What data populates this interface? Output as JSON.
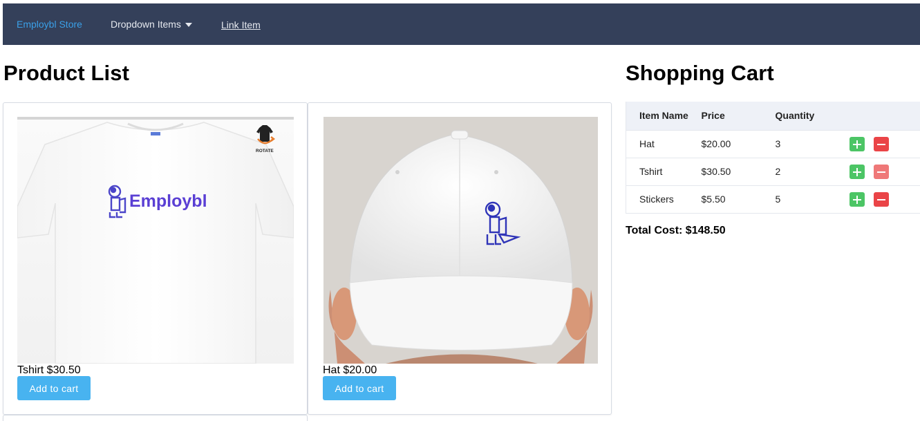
{
  "navbar": {
    "brand": "Employbl Store",
    "dropdown_label": "Dropdown Items",
    "link_label": "Link Item"
  },
  "products": {
    "title": "Product List",
    "items": [
      {
        "name": "Tshirt",
        "price_line": "Tshirt $30.50",
        "button_label": "Add to cart",
        "image_text": "Employbl",
        "rotate_label": "ROTATE"
      },
      {
        "name": "Hat",
        "price_line": "Hat $20.00",
        "button_label": "Add to cart"
      }
    ]
  },
  "cart": {
    "title": "Shopping Cart",
    "columns": [
      "Item Name",
      "Price",
      "Quantity"
    ],
    "rows": [
      {
        "name": "Hat",
        "price": "$20.00",
        "quantity": "3"
      },
      {
        "name": "Tshirt",
        "price": "$30.50",
        "quantity": "2"
      },
      {
        "name": "Stickers",
        "price": "$5.50",
        "quantity": "5"
      }
    ],
    "total": "Total Cost: $148.50"
  },
  "colors": {
    "navbar_bg": "#34405a",
    "brand": "#3aa0e8",
    "button_blue": "#48b3f0",
    "plus_green": "#4cc565",
    "minus_red": "#ea4447"
  },
  "icons": [
    "caret-down-icon",
    "plus-icon",
    "minus-icon",
    "tshirt-rotate-icon"
  ]
}
